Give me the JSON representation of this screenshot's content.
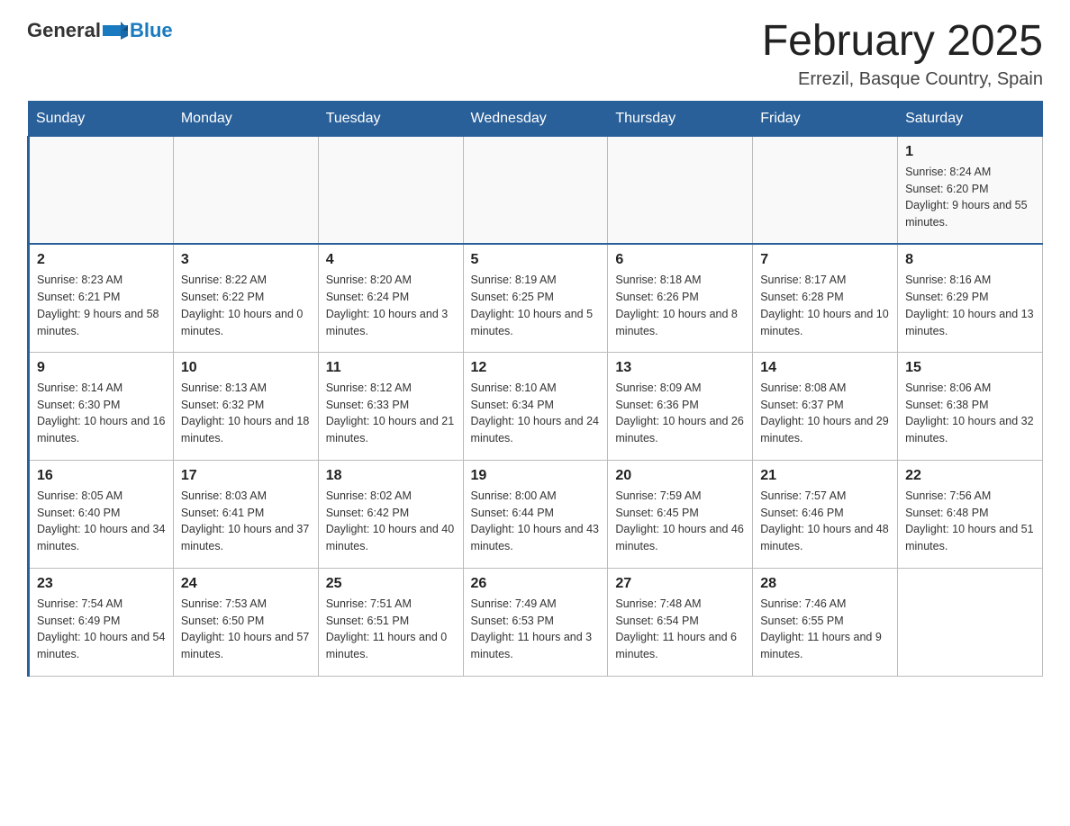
{
  "logo": {
    "general": "General",
    "blue": "Blue"
  },
  "header": {
    "title": "February 2025",
    "subtitle": "Errezil, Basque Country, Spain"
  },
  "weekdays": [
    "Sunday",
    "Monday",
    "Tuesday",
    "Wednesday",
    "Thursday",
    "Friday",
    "Saturday"
  ],
  "weeks": [
    [
      {
        "day": "",
        "info": ""
      },
      {
        "day": "",
        "info": ""
      },
      {
        "day": "",
        "info": ""
      },
      {
        "day": "",
        "info": ""
      },
      {
        "day": "",
        "info": ""
      },
      {
        "day": "",
        "info": ""
      },
      {
        "day": "1",
        "info": "Sunrise: 8:24 AM\nSunset: 6:20 PM\nDaylight: 9 hours and 55 minutes."
      }
    ],
    [
      {
        "day": "2",
        "info": "Sunrise: 8:23 AM\nSunset: 6:21 PM\nDaylight: 9 hours and 58 minutes."
      },
      {
        "day": "3",
        "info": "Sunrise: 8:22 AM\nSunset: 6:22 PM\nDaylight: 10 hours and 0 minutes."
      },
      {
        "day": "4",
        "info": "Sunrise: 8:20 AM\nSunset: 6:24 PM\nDaylight: 10 hours and 3 minutes."
      },
      {
        "day": "5",
        "info": "Sunrise: 8:19 AM\nSunset: 6:25 PM\nDaylight: 10 hours and 5 minutes."
      },
      {
        "day": "6",
        "info": "Sunrise: 8:18 AM\nSunset: 6:26 PM\nDaylight: 10 hours and 8 minutes."
      },
      {
        "day": "7",
        "info": "Sunrise: 8:17 AM\nSunset: 6:28 PM\nDaylight: 10 hours and 10 minutes."
      },
      {
        "day": "8",
        "info": "Sunrise: 8:16 AM\nSunset: 6:29 PM\nDaylight: 10 hours and 13 minutes."
      }
    ],
    [
      {
        "day": "9",
        "info": "Sunrise: 8:14 AM\nSunset: 6:30 PM\nDaylight: 10 hours and 16 minutes."
      },
      {
        "day": "10",
        "info": "Sunrise: 8:13 AM\nSunset: 6:32 PM\nDaylight: 10 hours and 18 minutes."
      },
      {
        "day": "11",
        "info": "Sunrise: 8:12 AM\nSunset: 6:33 PM\nDaylight: 10 hours and 21 minutes."
      },
      {
        "day": "12",
        "info": "Sunrise: 8:10 AM\nSunset: 6:34 PM\nDaylight: 10 hours and 24 minutes."
      },
      {
        "day": "13",
        "info": "Sunrise: 8:09 AM\nSunset: 6:36 PM\nDaylight: 10 hours and 26 minutes."
      },
      {
        "day": "14",
        "info": "Sunrise: 8:08 AM\nSunset: 6:37 PM\nDaylight: 10 hours and 29 minutes."
      },
      {
        "day": "15",
        "info": "Sunrise: 8:06 AM\nSunset: 6:38 PM\nDaylight: 10 hours and 32 minutes."
      }
    ],
    [
      {
        "day": "16",
        "info": "Sunrise: 8:05 AM\nSunset: 6:40 PM\nDaylight: 10 hours and 34 minutes."
      },
      {
        "day": "17",
        "info": "Sunrise: 8:03 AM\nSunset: 6:41 PM\nDaylight: 10 hours and 37 minutes."
      },
      {
        "day": "18",
        "info": "Sunrise: 8:02 AM\nSunset: 6:42 PM\nDaylight: 10 hours and 40 minutes."
      },
      {
        "day": "19",
        "info": "Sunrise: 8:00 AM\nSunset: 6:44 PM\nDaylight: 10 hours and 43 minutes."
      },
      {
        "day": "20",
        "info": "Sunrise: 7:59 AM\nSunset: 6:45 PM\nDaylight: 10 hours and 46 minutes."
      },
      {
        "day": "21",
        "info": "Sunrise: 7:57 AM\nSunset: 6:46 PM\nDaylight: 10 hours and 48 minutes."
      },
      {
        "day": "22",
        "info": "Sunrise: 7:56 AM\nSunset: 6:48 PM\nDaylight: 10 hours and 51 minutes."
      }
    ],
    [
      {
        "day": "23",
        "info": "Sunrise: 7:54 AM\nSunset: 6:49 PM\nDaylight: 10 hours and 54 minutes."
      },
      {
        "day": "24",
        "info": "Sunrise: 7:53 AM\nSunset: 6:50 PM\nDaylight: 10 hours and 57 minutes."
      },
      {
        "day": "25",
        "info": "Sunrise: 7:51 AM\nSunset: 6:51 PM\nDaylight: 11 hours and 0 minutes."
      },
      {
        "day": "26",
        "info": "Sunrise: 7:49 AM\nSunset: 6:53 PM\nDaylight: 11 hours and 3 minutes."
      },
      {
        "day": "27",
        "info": "Sunrise: 7:48 AM\nSunset: 6:54 PM\nDaylight: 11 hours and 6 minutes."
      },
      {
        "day": "28",
        "info": "Sunrise: 7:46 AM\nSunset: 6:55 PM\nDaylight: 11 hours and 9 minutes."
      },
      {
        "day": "",
        "info": ""
      }
    ]
  ]
}
